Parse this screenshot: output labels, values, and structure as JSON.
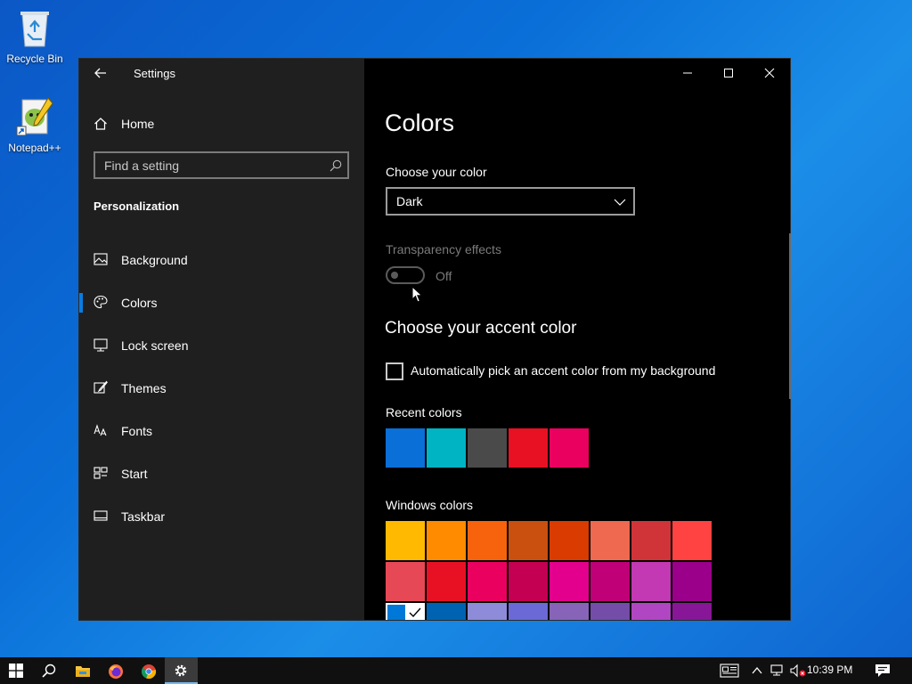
{
  "desktop": {
    "icons": [
      {
        "label": "Recycle Bin",
        "icon": "recycle-bin-icon"
      },
      {
        "label": "Notepad++",
        "icon": "notepad-plus-plus-icon"
      }
    ]
  },
  "window": {
    "title": "Settings",
    "sidebar": {
      "home_label": "Home",
      "search_placeholder": "Find a setting",
      "section_label": "Personalization",
      "items": [
        {
          "label": "Background",
          "icon": "image-icon"
        },
        {
          "label": "Colors",
          "icon": "palette-icon",
          "selected": true
        },
        {
          "label": "Lock screen",
          "icon": "lock-screen-icon"
        },
        {
          "label": "Themes",
          "icon": "themes-brush-icon"
        },
        {
          "label": "Fonts",
          "icon": "fonts-icon"
        },
        {
          "label": "Start",
          "icon": "start-grid-icon"
        },
        {
          "label": "Taskbar",
          "icon": "taskbar-icon"
        }
      ]
    },
    "content": {
      "heading": "Colors",
      "choose_color_label": "Choose your color",
      "color_mode_value": "Dark",
      "transparency_label": "Transparency effects",
      "transparency_state": "Off",
      "accent_heading": "Choose your accent color",
      "auto_accent_label": "Automatically pick an accent color from my background",
      "recent_colors_label": "Recent colors",
      "recent_colors": [
        "#0a6fd6",
        "#00b4c4",
        "#4a4a4a",
        "#e81123",
        "#ea005e"
      ],
      "windows_colors_label": "Windows colors",
      "windows_colors": [
        [
          "#ffb900",
          "#ff8c00",
          "#f7630c",
          "#ca5010",
          "#da3b01",
          "#ef6950",
          "#d13438",
          "#ff4343"
        ],
        [
          "#e74856",
          "#e81123",
          "#ea005e",
          "#c30052",
          "#e3008c",
          "#bf0077",
          "#c239b3",
          "#9a0089"
        ],
        [
          "#0078d7",
          "#0063b1",
          "#8e8cd8",
          "#6b69d6",
          "#8764b8",
          "#744da9",
          "#b146c2",
          "#881798"
        ]
      ]
    }
  },
  "taskbar": {
    "time": "10:39 PM",
    "accent": "#76b9ed"
  }
}
